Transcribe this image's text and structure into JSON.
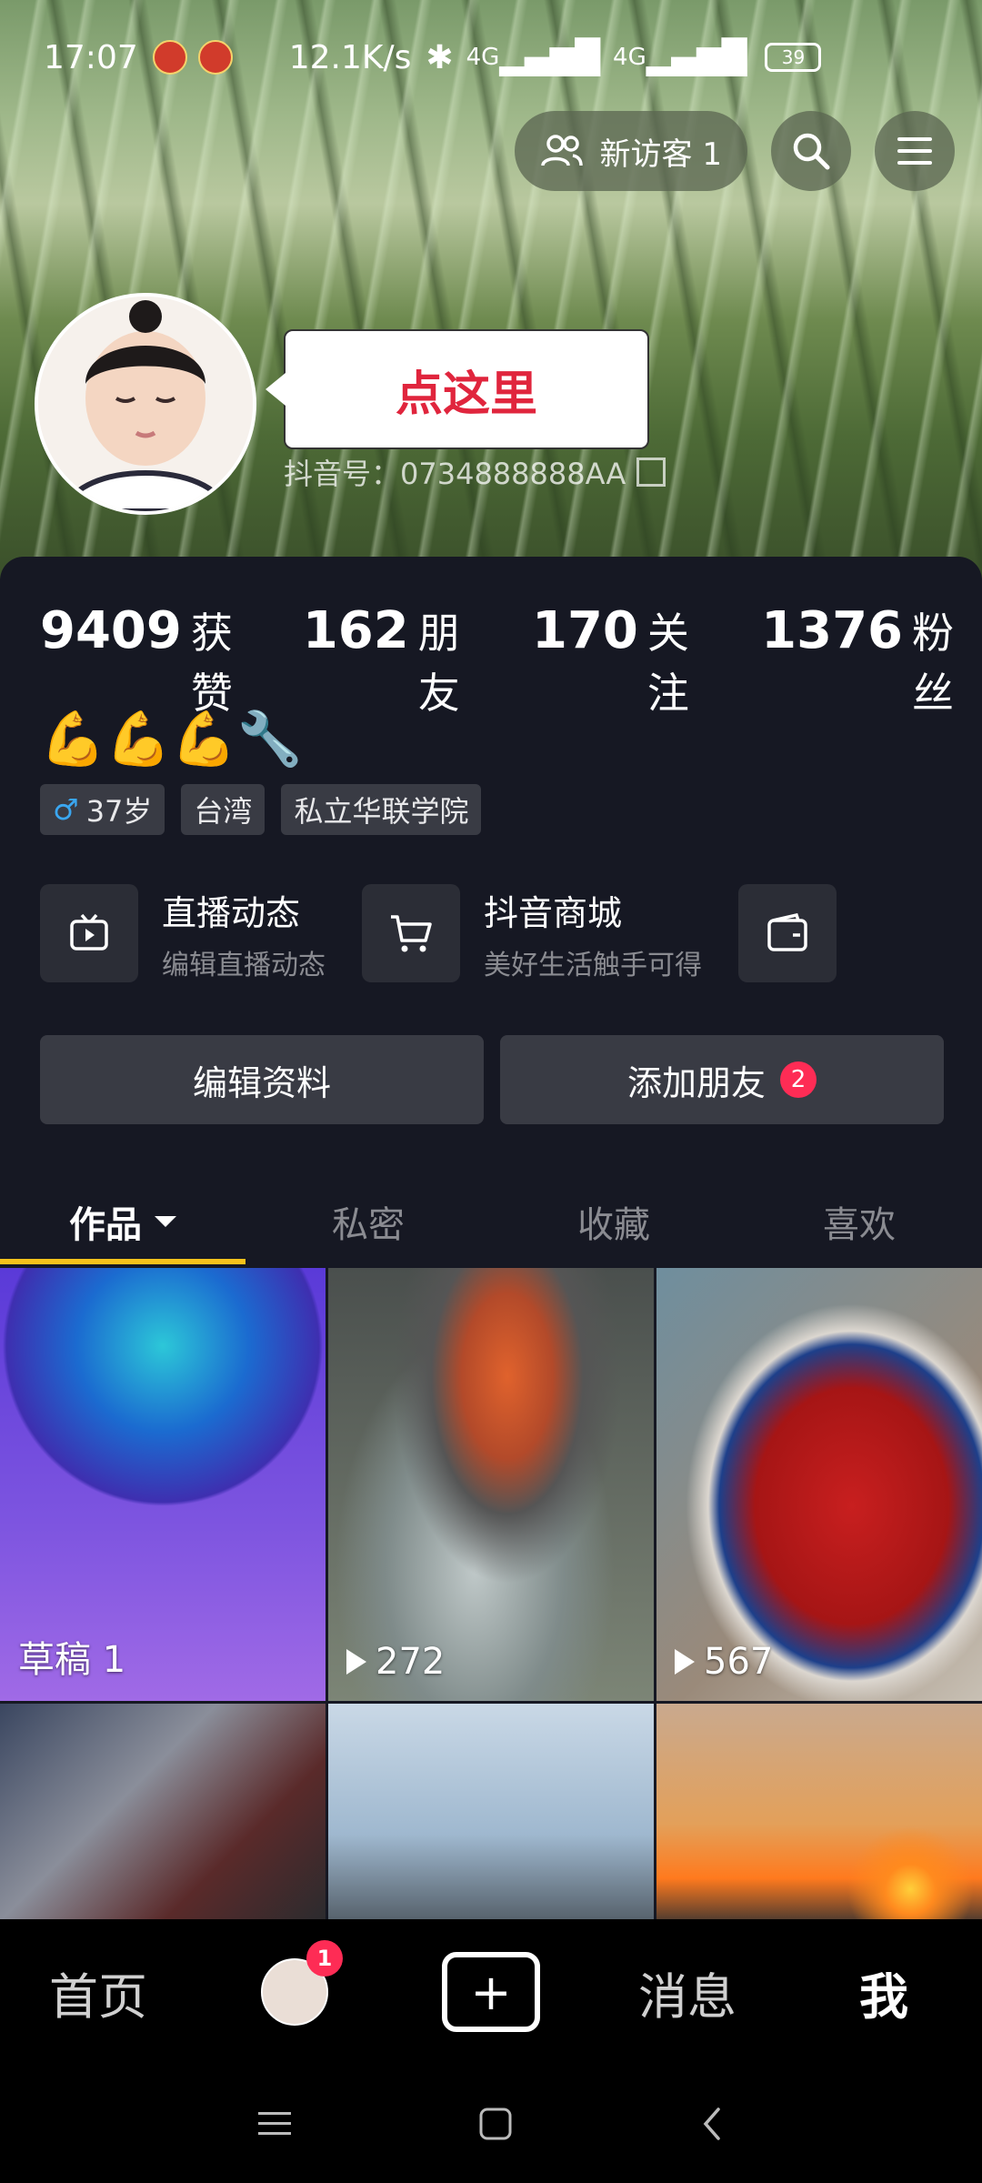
{
  "status_bar": {
    "time": "17:07",
    "net_speed": "12.1K/s",
    "signal1": "4G",
    "signal2": "4G",
    "battery": "39"
  },
  "header": {
    "visitors_label": "新访客 1"
  },
  "profile": {
    "bubble_text": "点这里",
    "douyin_id": "抖音号：0734888888AA",
    "bio": "💪💪💪🔧"
  },
  "stats": [
    {
      "num": "9409",
      "label": "获赞"
    },
    {
      "num": "162",
      "label": "朋友"
    },
    {
      "num": "170",
      "label": "关注"
    },
    {
      "num": "1376",
      "label": "粉丝"
    }
  ],
  "tags": {
    "gender_symbol": "♂",
    "age": "37岁",
    "region": "台湾",
    "school": "私立华联学院"
  },
  "services": [
    {
      "title": "直播动态",
      "sub": "编辑直播动态"
    },
    {
      "title": "抖音商城",
      "sub": "美好生活触手可得"
    }
  ],
  "actions": {
    "edit_profile": "编辑资料",
    "add_friend": "添加朋友",
    "add_friend_badge": "2"
  },
  "tabs": [
    "作品",
    "私密",
    "收藏",
    "喜欢"
  ],
  "grid": {
    "draft_label": "草稿 1",
    "video2_views": "272",
    "video3_views": "567"
  },
  "bottom_nav": {
    "home": "首页",
    "friend_badge": "1",
    "plus": "+",
    "messages": "消息",
    "me": "我"
  },
  "colors": {
    "accent_red": "#fe2c55",
    "tab_underline": "#f7c21b",
    "background": "#161823"
  }
}
